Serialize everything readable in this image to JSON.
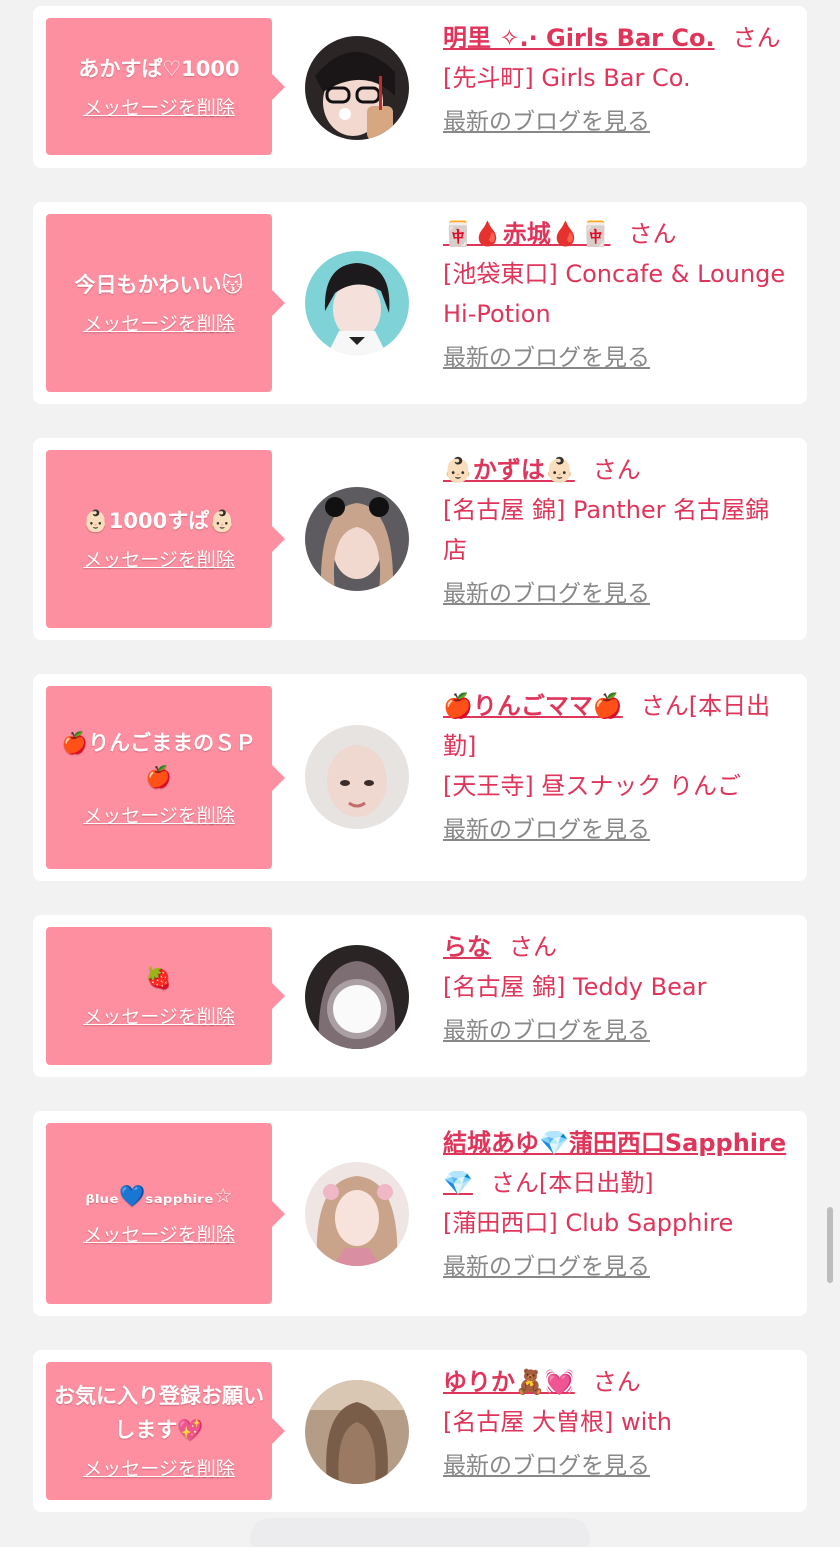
{
  "favorites": [
    {
      "message": "あかすぱ♡1000",
      "delete_label": "メッセージを削除",
      "name": "明里 ✧.· Girls Bar Co.",
      "honorific": "さん",
      "status": "",
      "shop": "[先斗町] Girls Bar Co.",
      "blog_label": "最新のブログを見る"
    },
    {
      "message": "今日もかわいい😽",
      "delete_label": "メッセージを削除",
      "name": "🀄🩸赤城🩸🀄",
      "honorific": "さん",
      "status": "",
      "shop": "[池袋東口] Concafe & Lounge Hi-Potion",
      "blog_label": "最新のブログを見る"
    },
    {
      "message": "👶🏻1000すぱ👶🏻",
      "delete_label": "メッセージを削除",
      "name": "👶🏻かずは👶🏻",
      "honorific": "さん",
      "status": "",
      "shop": "[名古屋 錦] Panther 名古屋錦店",
      "blog_label": "最新のブログを見る"
    },
    {
      "message": "🍎りんごままのＳＰ🍎",
      "delete_label": "メッセージを削除",
      "name": "🍎りんごママ🍎",
      "honorific": "さん",
      "status": "[本日出勤]",
      "shop": "[天王寺] 昼スナック りんご",
      "blog_label": "最新のブログを見る"
    },
    {
      "message": "🍓",
      "delete_label": "メッセージを削除",
      "name": "らな",
      "honorific": "さん",
      "status": "",
      "shop": "[名古屋 錦] Teddy Bear",
      "blog_label": "最新のブログを見る"
    },
    {
      "message": "ᵦₗᵤₑ💙ₛₐₚₚₕᵢᵣₑ☆",
      "delete_label": "メッセージを削除",
      "name": "結城あゆ💎蒲田西口Sapphire💎",
      "honorific": "さん",
      "status": "[本日出勤]",
      "shop": "[蒲田西口] Club Sapphire",
      "blog_label": "最新のブログを見る"
    },
    {
      "message": "お気に入り登録お願いします💖",
      "delete_label": "メッセージを削除",
      "name": "ゆりか🧸💓",
      "honorific": "さん",
      "status": "",
      "shop": "[名古屋 大曽根] with",
      "blog_label": "最新のブログを見る"
    }
  ],
  "colors": {
    "page_bg": "#f2f2f3",
    "bubble": "#fd8fa0",
    "accent_text": "#e0355a",
    "link_gray": "#888888"
  }
}
